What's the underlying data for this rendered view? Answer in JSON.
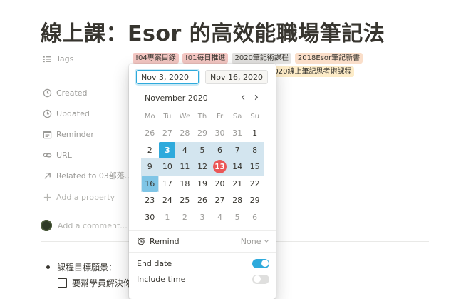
{
  "page": {
    "title": "線上課：Esor 的高效能職場筆記法"
  },
  "properties": {
    "tags": {
      "label": "Tags",
      "values": [
        {
          "text": "!04專案目錄",
          "color": "#f4c7c3"
        },
        {
          "text": "!01每日推進",
          "color": "#f4c7c3"
        },
        {
          "text": "2020筆記術課程",
          "color": "#e3e2e0"
        },
        {
          "text": "2018Esor筆記新書",
          "color": "#fadec9"
        },
        {
          "text": "2020線上筆記思考術課程",
          "color": "#fdecc8"
        }
      ]
    },
    "created": "Created",
    "updated": "Updated",
    "reminder": "Reminder",
    "url": "URL",
    "related": "Related to 03部落...",
    "add_property": "Add a property"
  },
  "comment_placeholder": "Add a comment...",
  "body": {
    "bullet": "課程目標願景：",
    "todo": "要幫學員解決你"
  },
  "date_picker": {
    "start_date": "Nov 3, 2020",
    "end_date": "Nov 16, 2020",
    "month": "November 2020",
    "weekdays": [
      "Mo",
      "Tu",
      "We",
      "Th",
      "Fr",
      "Sa",
      "Su"
    ],
    "weeks": [
      [
        "26",
        "27",
        "28",
        "29",
        "30",
        "31",
        "1"
      ],
      [
        "2",
        "3",
        "4",
        "5",
        "6",
        "7",
        "8"
      ],
      [
        "9",
        "10",
        "11",
        "12",
        "13",
        "14",
        "15"
      ],
      [
        "16",
        "17",
        "18",
        "19",
        "20",
        "21",
        "22"
      ],
      [
        "23",
        "24",
        "25",
        "26",
        "27",
        "28",
        "29"
      ],
      [
        "30",
        "1",
        "2",
        "3",
        "4",
        "5",
        "6"
      ]
    ],
    "remind_label": "Remind",
    "remind_value": "None",
    "end_date_label": "End date",
    "end_date_enabled": true,
    "include_time_label": "Include time",
    "include_time_enabled": false,
    "accent_color": "#2eaadc",
    "today_color": "#eb5757"
  }
}
